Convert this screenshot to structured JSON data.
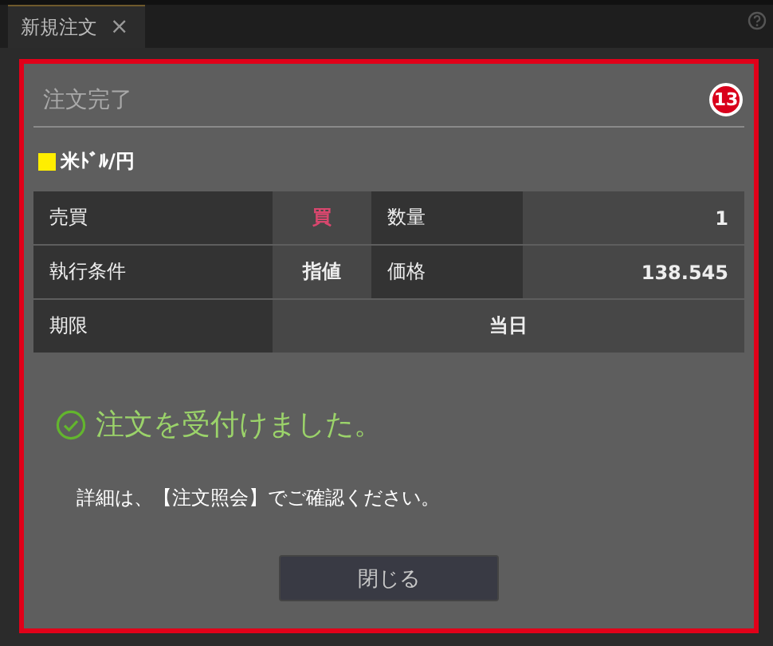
{
  "tab": {
    "label": "新規注文",
    "close": "×",
    "selected": true
  },
  "badge": "13",
  "title": "注文完了",
  "instrument": {
    "name": "米ﾄﾞﾙ/円",
    "color": "#ffee00"
  },
  "rows": [
    [
      {
        "label": "売買",
        "value": "買",
        "kind": "buy"
      },
      {
        "label": "数量",
        "value": "1",
        "kind": "number"
      }
    ],
    [
      {
        "label": "執行条件",
        "value": "指値",
        "kind": "text"
      },
      {
        "label": "価格",
        "value": "138.545",
        "kind": "number"
      }
    ],
    [
      {
        "label": "期限",
        "value": "当日",
        "kind": "wide"
      }
    ]
  ],
  "message": "注文を受付けました。",
  "note": "詳細は、【注文照会】でご確認ください。",
  "button": "閉じる"
}
